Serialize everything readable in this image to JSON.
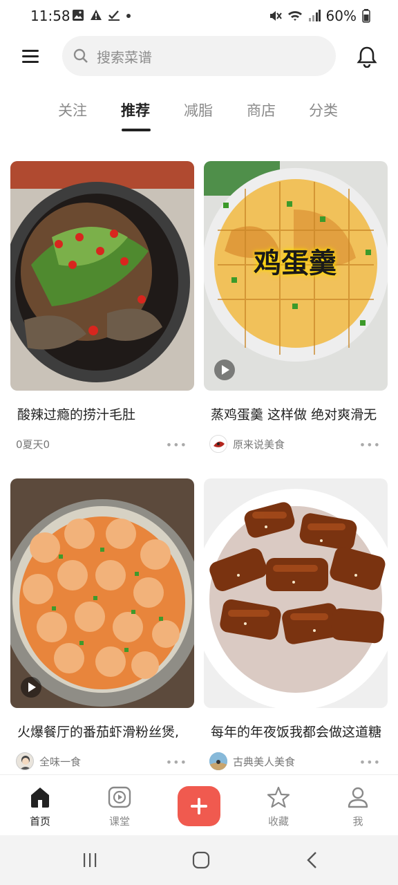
{
  "status_bar": {
    "time": "11:58",
    "battery": "60%"
  },
  "header": {
    "search_placeholder": "搜索菜谱"
  },
  "tabs": [
    {
      "label": "关注"
    },
    {
      "label": "推荐"
    },
    {
      "label": "减脂"
    },
    {
      "label": "商店"
    },
    {
      "label": "分类"
    }
  ],
  "cards": [
    {
      "title": "酸辣过瘾的捞汁毛肚",
      "author": "0夏天0",
      "video": false,
      "overlay_text": ""
    },
    {
      "title": "蒸鸡蛋羹 这样做 绝对爽滑无",
      "author": "原来说美食",
      "video": true,
      "overlay_text": "鸡蛋羹"
    },
    {
      "title": "火爆餐厅的番茄虾滑粉丝煲,",
      "author": "全味一食",
      "video": true,
      "overlay_text": ""
    },
    {
      "title": "每年的年夜饭我都会做这道糖",
      "author": "古典美人美食",
      "video": false,
      "overlay_text": ""
    }
  ],
  "more_label": "•••",
  "bottom_nav": [
    {
      "label": "首页"
    },
    {
      "label": "课堂"
    },
    {
      "label": "收藏"
    },
    {
      "label": "我"
    }
  ],
  "colors": {
    "accent": "#f05a4f",
    "text": "#222222",
    "muted": "#8a8a8a"
  }
}
